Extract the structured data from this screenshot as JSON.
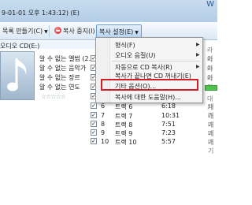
{
  "titlebar": {
    "datetime": "9-01-01 오후 1:43:12) (E)",
    "window_letter": "W"
  },
  "toolbar": {
    "playlist_label": "목록 만들기(C)",
    "stop_rip_label": "복사 중지(I)",
    "rip_settings_label": "복사 설정(E)"
  },
  "drive": {
    "label": "오디오 CD(E:)"
  },
  "album": {
    "line1": "알 수 없는 앨범 (2...",
    "line2": "알 수 없는 음악가",
    "line3": "알 수 없는 장르",
    "line4": "알 수 없는 연도",
    "rating": "☆☆☆☆☆"
  },
  "menu": {
    "items": [
      {
        "label": "형식(F)",
        "submenu": true
      },
      {
        "label": "오디오 음질(U)",
        "submenu": true
      },
      {
        "label": "자동으로 CD 복사(R)",
        "submenu": true
      },
      {
        "label": "복사가 끝나면 CD 꺼내기(E)",
        "submenu": false
      },
      {
        "label": "기타 옵션(O)...",
        "submenu": false
      },
      {
        "label": "복사에 대한 도움말(H)...",
        "submenu": false
      }
    ]
  },
  "tracks": [
    {
      "num": "6",
      "title": "트랙 6",
      "length": "6:18",
      "status": "대기"
    },
    {
      "num": "7",
      "title": "트랙 7",
      "length": "10:31",
      "status": "대기"
    },
    {
      "num": "8",
      "title": "트랙 8",
      "length": "7:51",
      "status": "대기"
    },
    {
      "num": "9",
      "title": "트랙 9",
      "length": "7:23",
      "status": "대기"
    },
    {
      "num": "10",
      "title": "트랙 10",
      "length": "5:57",
      "status": "대기"
    }
  ],
  "right_column": {
    "r1": "라이",
    "r2": "라이",
    "r3": "라이",
    "r4": "라이",
    "r5": "라이",
    "r6": "대기"
  },
  "colors": {
    "highlight_box": "#d21f27",
    "progress": "#4fc24f"
  }
}
